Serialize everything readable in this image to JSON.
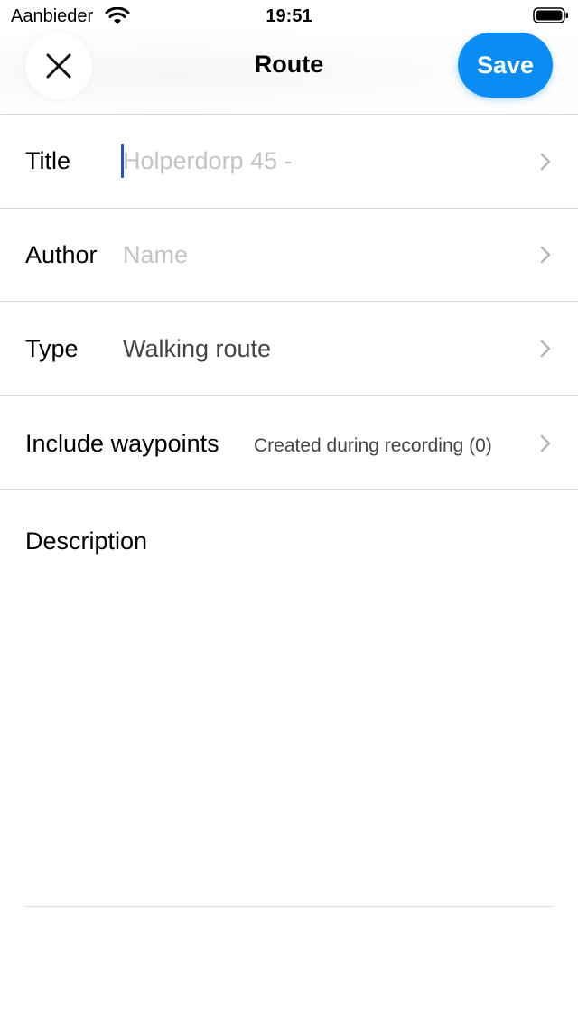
{
  "status_bar": {
    "carrier": "Aanbieder",
    "time": "19:51"
  },
  "header": {
    "title": "Route",
    "save_label": "Save"
  },
  "form": {
    "title": {
      "label": "Title",
      "placeholder": "Holperdorp 45 -",
      "value": ""
    },
    "author": {
      "label": "Author",
      "placeholder": "Name",
      "value": ""
    },
    "type": {
      "label": "Type",
      "value": "Walking route"
    },
    "waypoints": {
      "label": "Include waypoints",
      "value": "Created during recording (0)"
    },
    "description": {
      "label": "Description",
      "value": ""
    }
  },
  "colors": {
    "accent": "#0a8cf5",
    "cursor": "#1f4fe0",
    "placeholder": "#c4c4c8",
    "divider": "#dcdcdc"
  },
  "icons": {
    "close": "close-icon",
    "chevron": "chevron-right-icon",
    "wifi": "wifi-icon",
    "battery": "battery-icon"
  }
}
